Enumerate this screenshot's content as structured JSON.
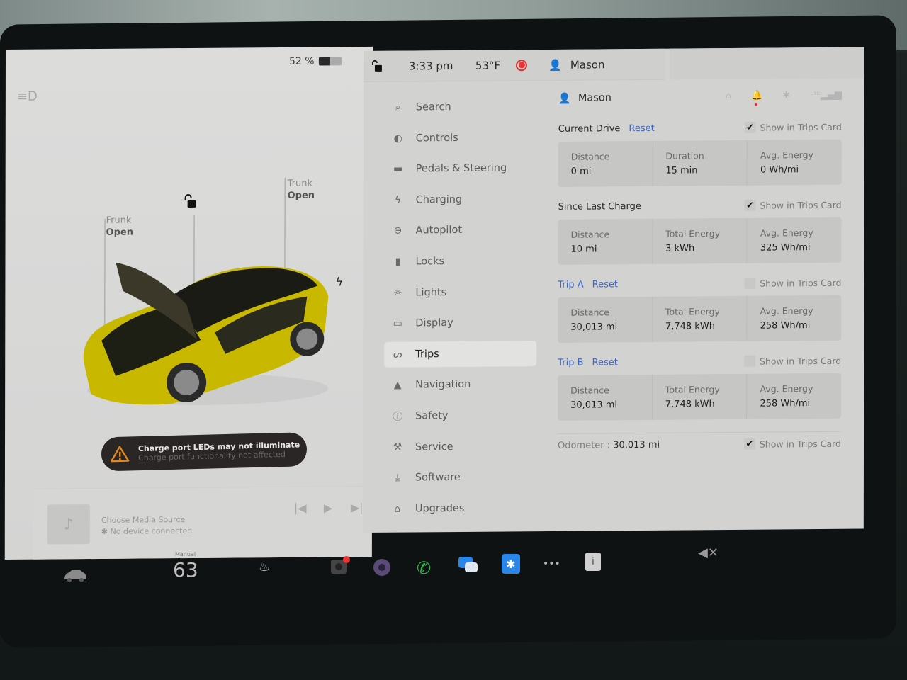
{
  "status_bar": {
    "battery_percent_label": "52 %",
    "battery_level": 0.52,
    "time": "3:33 pm",
    "temperature": "53°F",
    "user": "Mason"
  },
  "car_view": {
    "frunk": {
      "name": "Frunk",
      "state": "Open"
    },
    "trunk": {
      "name": "Trunk",
      "state": "Open"
    },
    "alert": {
      "title": "Charge port LEDs may not illuminate",
      "subtitle": "Charge port functionality not affected"
    },
    "car_color": "#d8c800"
  },
  "media": {
    "title": "Choose Media Source",
    "subtitle": "No device connected"
  },
  "nav": {
    "items": [
      {
        "label": "Search",
        "icon": "search-icon",
        "glyph": "⌕"
      },
      {
        "label": "Controls",
        "icon": "toggle-icon",
        "glyph": "◐"
      },
      {
        "label": "Pedals & Steering",
        "icon": "car-icon",
        "glyph": "▬"
      },
      {
        "label": "Charging",
        "icon": "bolt-icon",
        "glyph": "ϟ"
      },
      {
        "label": "Autopilot",
        "icon": "steering-wheel-icon",
        "glyph": "⊖"
      },
      {
        "label": "Locks",
        "icon": "lock-icon",
        "glyph": "▮"
      },
      {
        "label": "Lights",
        "icon": "sun-icon",
        "glyph": "☼"
      },
      {
        "label": "Display",
        "icon": "display-icon",
        "glyph": "▭"
      },
      {
        "label": "Trips",
        "icon": "route-icon",
        "glyph": "ᔕ"
      },
      {
        "label": "Navigation",
        "icon": "navigation-arrow-icon",
        "glyph": "▲"
      },
      {
        "label": "Safety",
        "icon": "alert-circle-icon",
        "glyph": "ⓘ"
      },
      {
        "label": "Service",
        "icon": "wrench-icon",
        "glyph": "⚒"
      },
      {
        "label": "Software",
        "icon": "download-icon",
        "glyph": "⤓"
      },
      {
        "label": "Upgrades",
        "icon": "bag-icon",
        "glyph": "⌂"
      }
    ],
    "active": "Trips"
  },
  "content": {
    "profile_name": "Mason",
    "show_in_trips_card": "Show in Trips Card",
    "reset_label": "Reset",
    "sections": [
      {
        "title": "Current Drive",
        "title_blue": false,
        "has_reset": true,
        "show_checked": true,
        "stats": [
          {
            "label": "Distance",
            "value": "0 mi"
          },
          {
            "label": "Duration",
            "value": "15 min"
          },
          {
            "label": "Avg. Energy",
            "value": "0 Wh/mi"
          }
        ]
      },
      {
        "title": "Since Last Charge",
        "title_blue": false,
        "has_reset": false,
        "show_checked": true,
        "stats": [
          {
            "label": "Distance",
            "value": "10 mi"
          },
          {
            "label": "Total Energy",
            "value": "3 kWh"
          },
          {
            "label": "Avg. Energy",
            "value": "325 Wh/mi"
          }
        ]
      },
      {
        "title": "Trip A",
        "title_blue": true,
        "has_reset": true,
        "show_checked": false,
        "stats": [
          {
            "label": "Distance",
            "value": "30,013 mi"
          },
          {
            "label": "Total Energy",
            "value": "7,748 kWh"
          },
          {
            "label": "Avg. Energy",
            "value": "258 Wh/mi"
          }
        ]
      },
      {
        "title": "Trip B",
        "title_blue": true,
        "has_reset": true,
        "show_checked": false,
        "stats": [
          {
            "label": "Distance",
            "value": "30,013 mi"
          },
          {
            "label": "Total Energy",
            "value": "7,748 kWh"
          },
          {
            "label": "Avg. Energy",
            "value": "258 Wh/mi"
          }
        ]
      }
    ],
    "odometer": {
      "label": "Odometer",
      "value": "30,013 mi",
      "show_checked": true
    }
  },
  "dock": {
    "climate_mode": "Manual",
    "cabin_temp": "63"
  },
  "colors": {
    "accent_blue": "#3f66c6",
    "record_red": "#e33333",
    "alert_orange": "#e08a1e",
    "phone_green": "#2fc24a",
    "bluetooth_blue": "#2a86e8"
  }
}
